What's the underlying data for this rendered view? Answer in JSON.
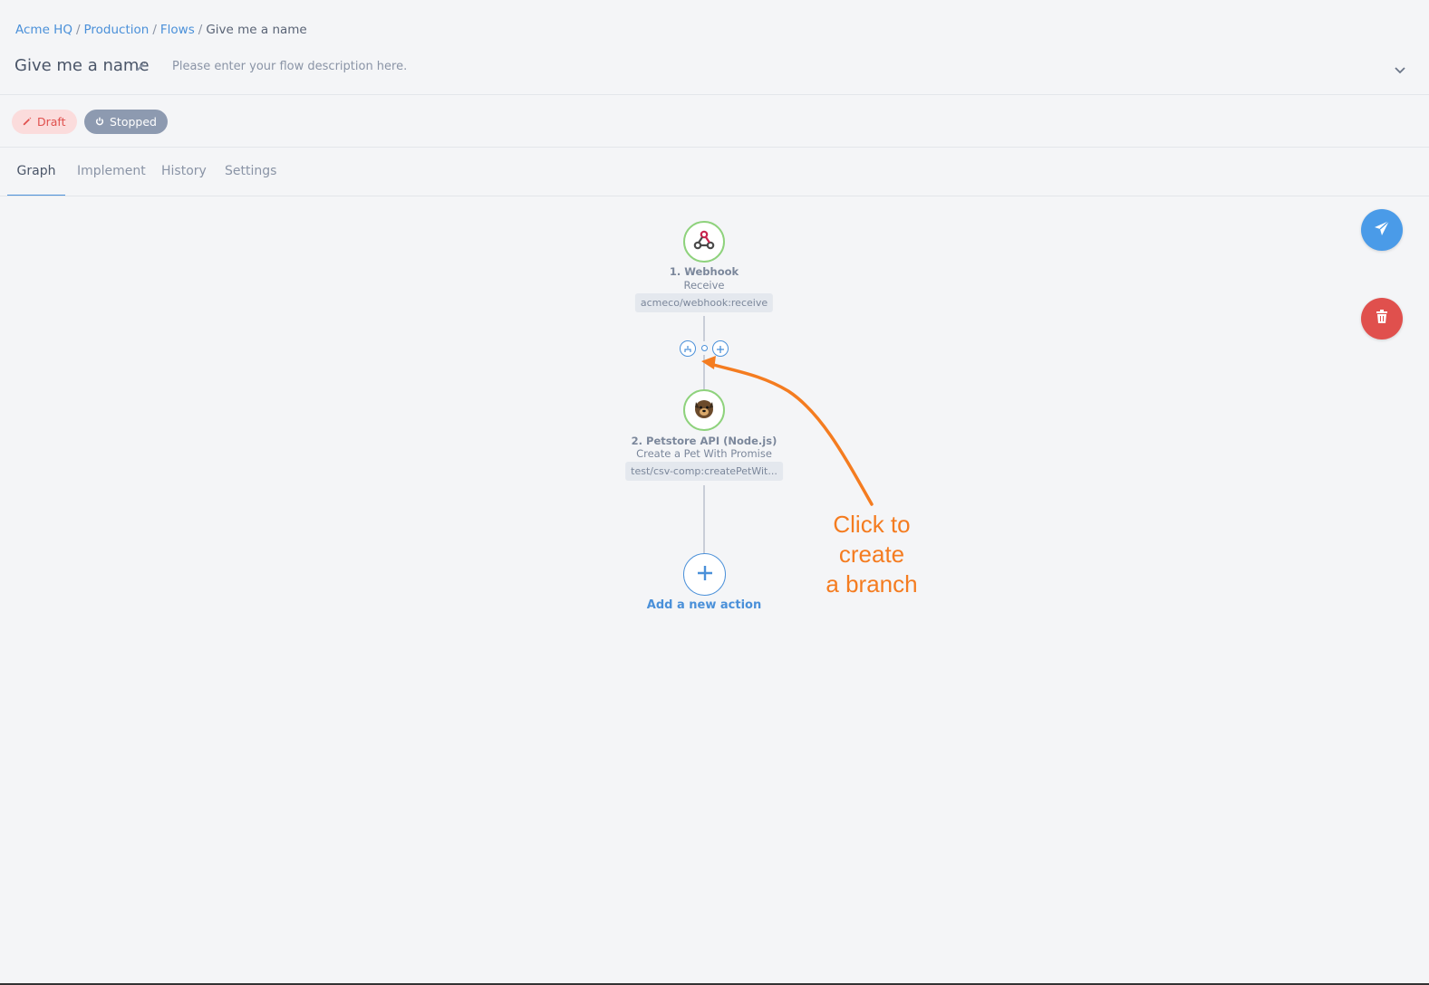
{
  "breadcrumb": {
    "items": [
      "Acme HQ",
      "Production",
      "Flows"
    ],
    "current": "Give me a name",
    "separator": "/"
  },
  "flow": {
    "title": "Give me a name",
    "description_placeholder": "Please enter your flow description here."
  },
  "badges": {
    "draft": "Draft",
    "stopped": "Stopped"
  },
  "tabs": [
    {
      "label": "Graph",
      "active": true
    },
    {
      "label": "Implement",
      "active": false
    },
    {
      "label": "History",
      "active": false
    },
    {
      "label": "Settings",
      "active": false
    }
  ],
  "graph": {
    "nodes": [
      {
        "title": "1. Webhook",
        "subtitle": "Receive",
        "tag": "acmeco/webhook:receive",
        "icon": "webhook-icon"
      },
      {
        "title": "2. Petstore API (Node.js)",
        "subtitle": "Create a Pet With Promise",
        "tag": "test/csv-comp:createPetWit...",
        "icon": "petstore-dog-icon"
      }
    ],
    "add_action_label": "Add a new action"
  },
  "annotation": {
    "line1": "Click to create",
    "line2": "a branch"
  },
  "colors": {
    "accent": "#4a90d9",
    "node_border": "#8ed27c",
    "draft_bg": "#fbdcdc",
    "draft_text": "#e0504d",
    "stopped_bg": "#8d9ab0",
    "run_button": "#4a9be8",
    "delete_button": "#e0504d",
    "annotation": "#f47c20"
  }
}
